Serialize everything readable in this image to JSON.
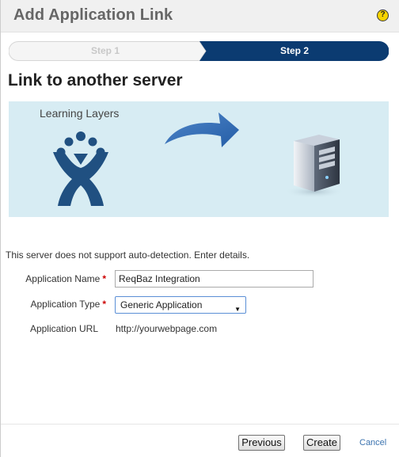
{
  "dialog": {
    "title": "Add Application Link",
    "help_icon": "question-circle-icon",
    "help_glyph": "?"
  },
  "progress": {
    "steps": [
      {
        "label": "Step 1",
        "state": "inactive"
      },
      {
        "label": "Step 2",
        "state": "active"
      }
    ],
    "active_color": "#0b3b71",
    "inactive_color": "#f5f5f5"
  },
  "page": {
    "heading": "Link to another server"
  },
  "banner": {
    "source_label": "Learning Layers",
    "source_icon": "atlassian-logo-icon",
    "arrow_icon": "curved-arrow-right-icon",
    "target_icon": "server-icon",
    "background_color": "#d7ecf3"
  },
  "form": {
    "intro": "This server does not support auto-detection. Enter details.",
    "required_mark": "*",
    "name_label": "Application Name",
    "name_value": "ReqBaz Integration",
    "type_label": "Application Type",
    "type_value": "Generic Application",
    "url_label": "Application URL",
    "url_value": "http://yourwebpage.com"
  },
  "footer": {
    "previous_label": "Previous",
    "create_label": "Create",
    "cancel_label": "Cancel"
  }
}
